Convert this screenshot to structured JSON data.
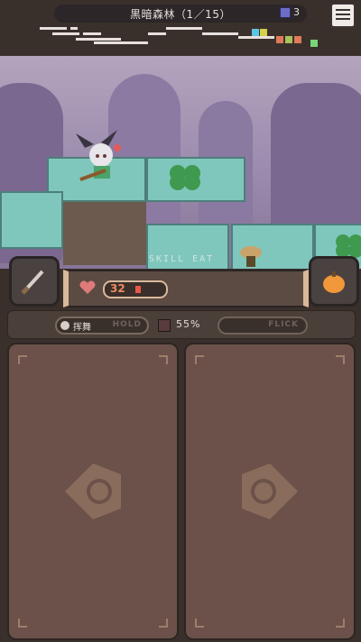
{
  "top_bar": {
    "stage_title": "黒暗森林（1／15）",
    "skull_count": "3"
  },
  "minimap": {
    "node_colors": [
      "#5bc5e6",
      "#d6d04a",
      "#e07a5a",
      "#a8c35a",
      "#7ad57a"
    ]
  },
  "scene": {
    "skill_label": "SKILL EAT"
  },
  "hud": {
    "hp_value": "32",
    "hp_fraction": 0.08
  },
  "action_bar": {
    "hold_label": "挥舞",
    "hold_mode": "HOLD",
    "percent": "55%",
    "flick_mode": "FLICK"
  },
  "icons": {
    "left_button": "sword-icon",
    "right_button": "pumpkin-item-icon"
  }
}
